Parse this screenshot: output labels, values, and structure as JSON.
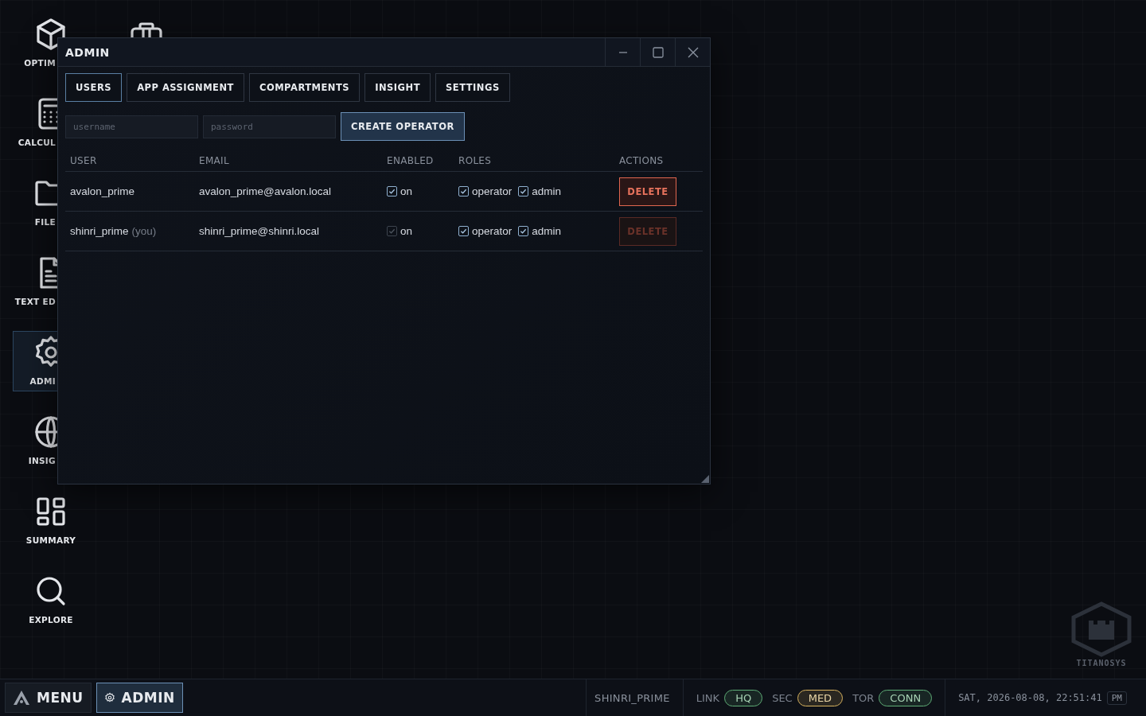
{
  "desktop": {
    "icons": [
      {
        "kind": "cube",
        "label": "OPTIM",
        "covered": true,
        "selected": false
      },
      {
        "kind": "calculator",
        "label": "CALCUL",
        "covered": true,
        "selected": false
      },
      {
        "kind": "folder",
        "label": "FILE",
        "covered": true,
        "selected": false
      },
      {
        "kind": "document",
        "label": "TEXT ED",
        "covered": true,
        "selected": false
      },
      {
        "kind": "gear",
        "label": "ADMI",
        "covered": true,
        "selected": true
      },
      {
        "kind": "globe",
        "label": "INSIG",
        "covered": true,
        "selected": false
      },
      {
        "kind": "grid",
        "label": "SUMMARY",
        "covered": false,
        "selected": false
      },
      {
        "kind": "search",
        "label": "EXPLORE",
        "covered": false,
        "selected": false
      }
    ],
    "logo_text": "TITANOSYS"
  },
  "window": {
    "title": "ADMIN",
    "tabs": [
      {
        "label": "USERS",
        "selected": true
      },
      {
        "label": "APP ASSIGNMENT",
        "selected": false
      },
      {
        "label": "COMPARTMENTS",
        "selected": false
      },
      {
        "label": "INSIGHT",
        "selected": false
      },
      {
        "label": "SETTINGS",
        "selected": false
      }
    ],
    "form": {
      "username_placeholder": "username",
      "password_placeholder": "password",
      "button": "CREATE OPERATOR"
    },
    "table": {
      "columns": [
        "USER",
        "EMAIL",
        "ENABLED",
        "ROLES",
        "ACTIONS"
      ],
      "rows": [
        {
          "user": "avalon_prime",
          "you": "",
          "email": "avalon_prime@avalon.local",
          "enabled": {
            "label": "on",
            "checked": true,
            "disabled": false
          },
          "roles": [
            {
              "label": "operator",
              "checked": true
            },
            {
              "label": "admin",
              "checked": true
            }
          ],
          "action": {
            "label": "DELETE",
            "disabled": false
          }
        },
        {
          "user": "shinri_prime",
          "you": "(you)",
          "email": "shinri_prime@shinri.local",
          "enabled": {
            "label": "on",
            "checked": true,
            "disabled": true
          },
          "roles": [
            {
              "label": "operator",
              "checked": true
            },
            {
              "label": "admin",
              "checked": true
            }
          ],
          "action": {
            "label": "DELETE",
            "disabled": true
          }
        }
      ]
    }
  },
  "taskbar": {
    "menu": "MENU",
    "apps": [
      {
        "label": "ADMIN",
        "selected": true
      }
    ],
    "user": "SHINRI_PRIME",
    "statuses": [
      {
        "label": "LINK",
        "value": "HQ",
        "color": "#5fae77"
      },
      {
        "label": "SEC",
        "value": "MED",
        "color": "#d9b45f"
      },
      {
        "label": "TOR",
        "value": "CONN",
        "color": "#5fae77"
      }
    ],
    "clock": "SAT, 2026-08-08, 22:51:41",
    "ampm": "PM"
  }
}
